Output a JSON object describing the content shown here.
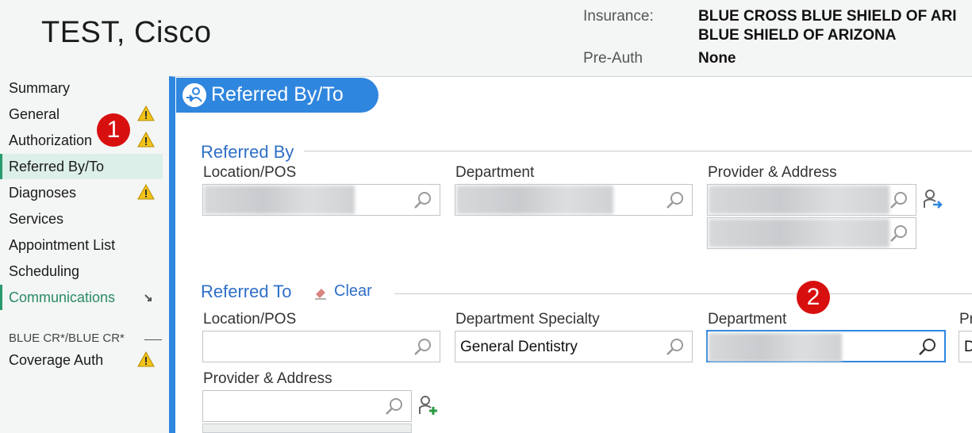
{
  "header": {
    "patient_name": "TEST, Cisco",
    "insurance_label": "Insurance:",
    "insurance_line1": "BLUE CROSS BLUE SHIELD OF ARI",
    "insurance_line2": "BLUE SHIELD OF ARIZONA",
    "preauth_label": "Pre-Auth",
    "preauth_value": "None"
  },
  "sidebar": {
    "items": [
      {
        "label": "Summary"
      },
      {
        "label": "General",
        "warning": true
      },
      {
        "label": "Authorization",
        "warning": true
      },
      {
        "label": "Referred By/To",
        "active": true
      },
      {
        "label": "Diagnoses",
        "warning": true
      },
      {
        "label": "Services"
      },
      {
        "label": "Appointment List"
      },
      {
        "label": "Scheduling"
      },
      {
        "label": "Communications"
      }
    ],
    "section_label": "BLUE CR*/BLUE CR*",
    "coverage_auth": "Coverage Auth"
  },
  "badges": {
    "one": "1",
    "two": "2"
  },
  "panel": {
    "title": "Referred By/To",
    "referred_by": {
      "title": "Referred By",
      "location_label": "Location/POS",
      "department_label": "Department",
      "provider_label": "Provider & Address"
    },
    "referred_to": {
      "title": "Referred To",
      "clear_label": "Clear",
      "location_label": "Location/POS",
      "specialty_label": "Department Specialty",
      "specialty_value": "General Dentistry",
      "department_label": "Department",
      "provider_partial_label": "Pr",
      "provider_partial_value": "D",
      "provider_label": "Provider & Address"
    }
  },
  "colors": {
    "accent": "#2f86de",
    "warning": "#f2c318",
    "badge": "#d80f0f",
    "active_bg": "#dcefe8"
  },
  "icons": [
    "search-icon",
    "warning-icon",
    "add-provider-icon",
    "eraser-icon",
    "referral-icon",
    "share-arrow-icon"
  ]
}
